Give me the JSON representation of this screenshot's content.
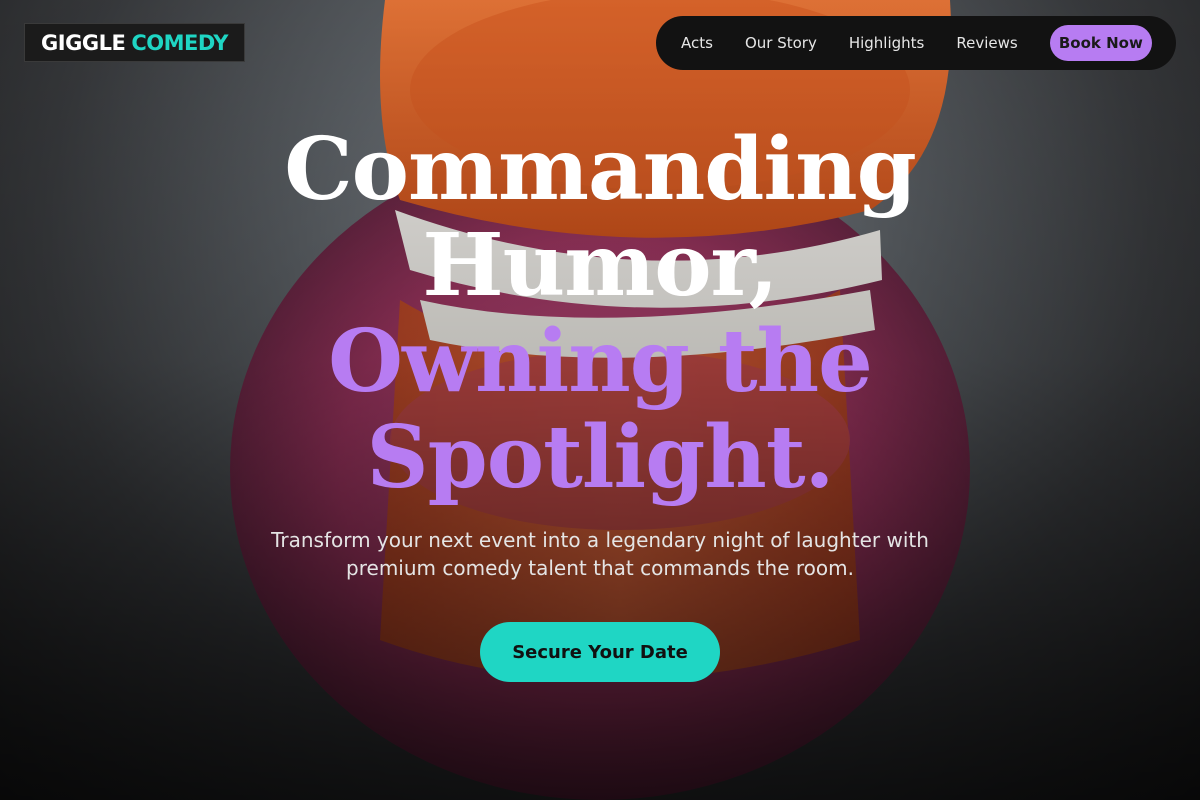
{
  "brand": {
    "logo_part1": "GIGGLE",
    "logo_part2": "COMEDY"
  },
  "nav": {
    "links": [
      "Acts",
      "Our Story",
      "Highlights",
      "Reviews"
    ],
    "book_label": "Book Now"
  },
  "hero": {
    "headline_white_1": "Commanding",
    "headline_white_2": "Humor,",
    "headline_purple_1": "Owning the",
    "headline_purple_2": "Spotlight.",
    "subtitle_line_1": "Transform your next event into a legendary night of laughter with",
    "subtitle_line_2": "premium comedy talent that commands the room.",
    "cta_label": "Secure Your Date"
  },
  "colors": {
    "accent_purple": "#b77cf2",
    "accent_teal": "#1fd6c4",
    "nav_background": "#121212"
  }
}
